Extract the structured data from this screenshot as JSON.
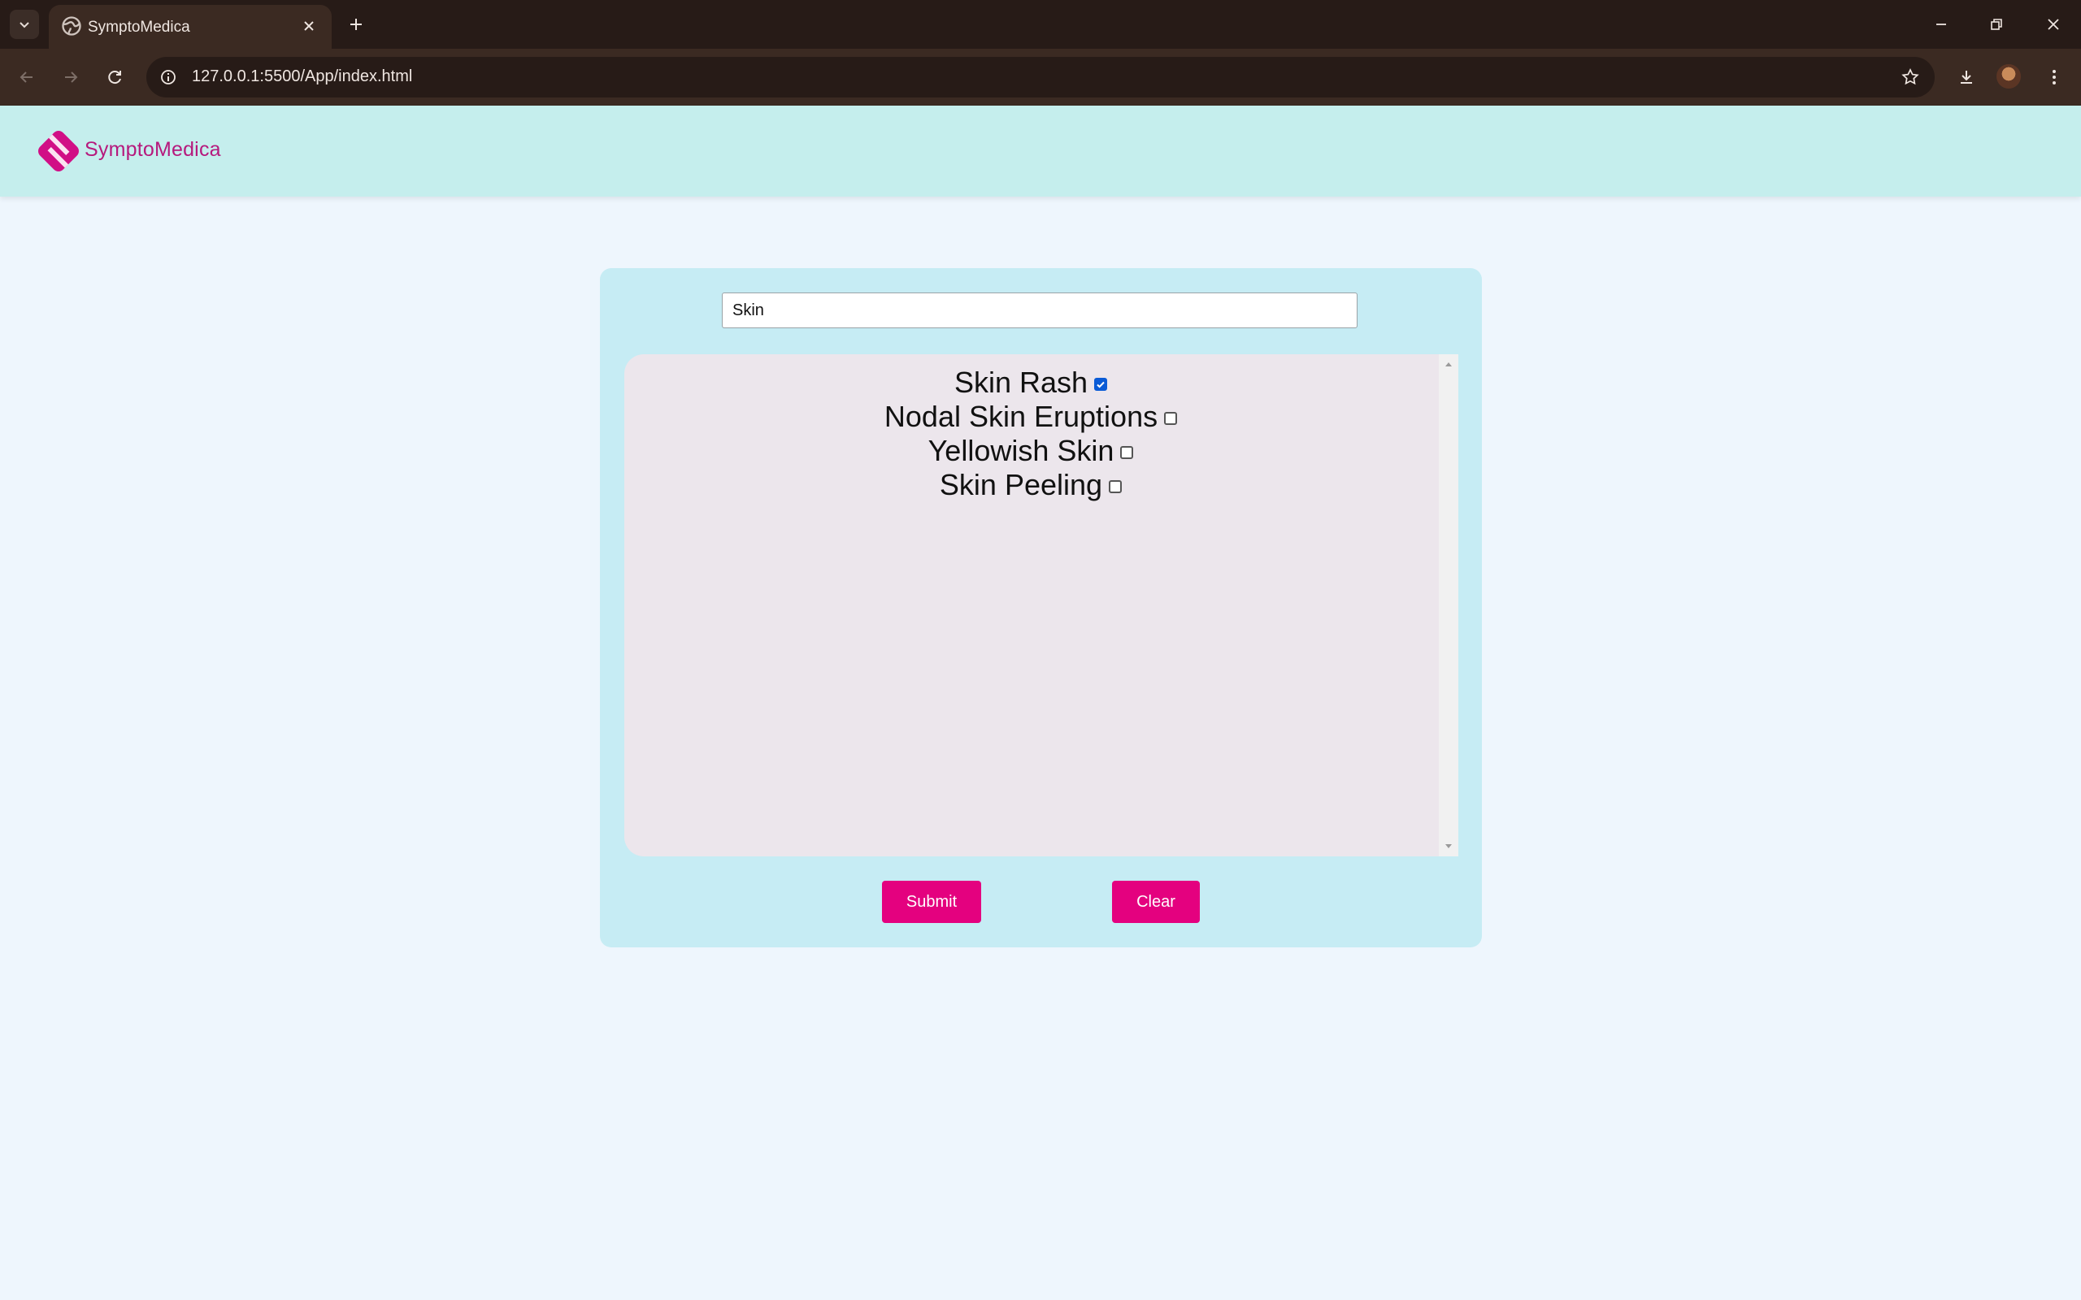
{
  "browser": {
    "tab_title": "SymptoMedica",
    "url": "127.0.0.1:5500/App/index.html"
  },
  "header": {
    "brand": "SymptoMedica"
  },
  "search": {
    "value": "Skin"
  },
  "symptoms": [
    {
      "label": "Skin Rash",
      "checked": true
    },
    {
      "label": "Nodal Skin Eruptions",
      "checked": false
    },
    {
      "label": "Yellowish Skin",
      "checked": false
    },
    {
      "label": "Skin Peeling",
      "checked": false
    }
  ],
  "buttons": {
    "submit": "Submit",
    "clear": "Clear"
  },
  "colors": {
    "accent": "#e4017f",
    "brand": "#b6197d",
    "header_bg": "#c5eeed",
    "card_bg": "#c6ecf4",
    "list_bg": "#ece6ec"
  }
}
